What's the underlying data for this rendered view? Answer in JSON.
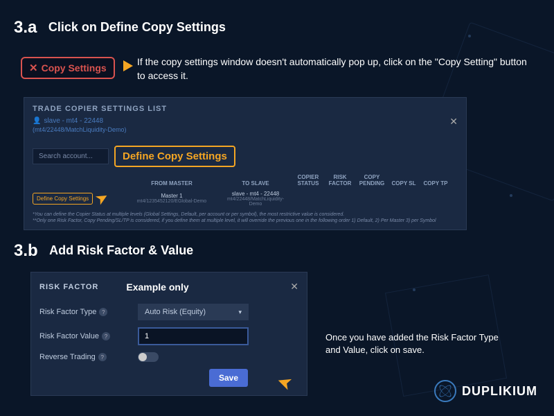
{
  "step_a": {
    "num": "3.a",
    "title": "Click on Define Copy Settings",
    "copy_btn": "Copy Settings",
    "note": "If the copy settings window doesn't automatically pop up, click on the \"Copy Setting\" button to access it."
  },
  "panel": {
    "title": "TRADE COPIER SETTINGS LIST",
    "slave": "slave - mt4 - 22448",
    "slave_sub": "(mt4/22448/MatchLiquidity-Demo)",
    "search_placeholder": "Search account...",
    "define_label": "Define Copy Settings",
    "headers": {
      "from": "FROM MASTER",
      "to": "TO SLAVE",
      "status": "COPIER STATUS",
      "risk": "RISK FACTOR",
      "pending": "COPY PENDING",
      "sl": "COPY SL",
      "tp": "COPY TP"
    },
    "row": {
      "define": "Define Copy Settings",
      "master": "Master 1",
      "master_sub": "mt4/1235452120/EGlobal-Demo",
      "slave": "slave - mt4 - 22448",
      "slave_sub": "mt4/22448/MatchLiquidity-Demo"
    },
    "footnote": "*You can define the Copier Status at multiple levels (Global Settings, Default, per account or per symbol), the most restrictive value is considered.\n**Only one Risk Factor, Copy Pending/SL/TP is considered, if you define them at multiple level, it will override the previous one in the following order 1) Default, 2) Per Master 3) per Symbol"
  },
  "step_b": {
    "num": "3.b",
    "title": "Add Risk Factor & Value",
    "note": "Once you have added the Risk Factor Type and Value, click on save."
  },
  "risk": {
    "title": "RISK FACTOR",
    "example": "Example only",
    "type_label": "Risk Factor Type",
    "value_label": "Risk Factor Value",
    "reverse_label": "Reverse Trading",
    "type_value": "Auto Risk (Equity)",
    "value_input": "1",
    "save": "Save"
  },
  "brand": "DUPLIKIUM"
}
